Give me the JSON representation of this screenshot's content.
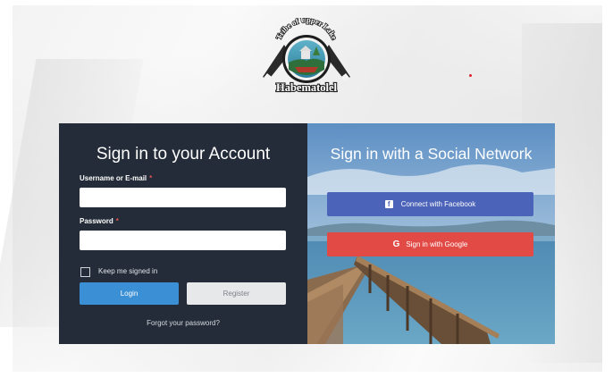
{
  "logo": {
    "arc_text": "Tribe of Upper Lake",
    "name": "Habematolel"
  },
  "signin": {
    "title": "Sign in to your Account",
    "username_label": "Username or E-mail",
    "password_label": "Password",
    "required_mark": "*",
    "username_value": "",
    "password_value": "",
    "keep_signed_in": "Keep me signed in",
    "keep_signed_in_checked": false,
    "login_button": "Login",
    "register_button": "Register",
    "forgot_link": "Forgot your password?"
  },
  "social": {
    "title": "Sign in with a Social Network",
    "facebook_button": "Connect with Facebook",
    "facebook_icon": "facebook-icon",
    "google_button": "Sign in with Google",
    "google_icon": "google-icon"
  },
  "colors": {
    "panel_dark": "#232c38",
    "login_blue": "#3b8fd5",
    "facebook_blue": "#4b63b8",
    "google_red": "#e24a46",
    "register_gray": "#e7e8ea"
  }
}
